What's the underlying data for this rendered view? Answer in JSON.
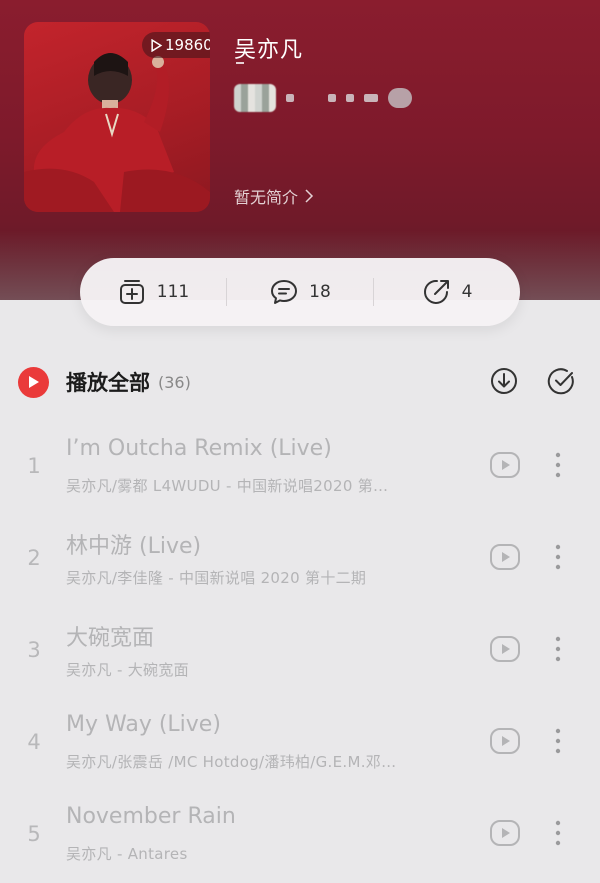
{
  "playlist": {
    "play_count": "19860",
    "title": "吴亦凡",
    "intro": "暂无简介"
  },
  "stats": {
    "collect": "111",
    "comments": "18",
    "share": "4"
  },
  "list_header": {
    "play_all_label": "播放全部",
    "count_label": "(36)"
  },
  "songs": [
    {
      "index": "1",
      "name": "I’m Outcha Remix (Live)",
      "artist": "吴亦凡/雾都 L4WUDU - 中国新说唱2020 第…"
    },
    {
      "index": "2",
      "name": "林中游 (Live)",
      "artist": "吴亦凡/李佳隆 - 中国新说唱 2020 第十二期"
    },
    {
      "index": "3",
      "name": "大碗宽面",
      "artist": "吴亦凡 - 大碗宽面"
    },
    {
      "index": "4",
      "name": "My Way (Live)",
      "artist": "吴亦凡/张震岳 /MC Hotdog/潘玮柏/G.E.M.邓…"
    },
    {
      "index": "5",
      "name": "November Rain",
      "artist": "吴亦凡 - Antares"
    }
  ],
  "colors": {
    "header_bg": "#7e1a2b",
    "accent_red": "#ea3a3a",
    "muted_text": "#b4b4b6"
  }
}
